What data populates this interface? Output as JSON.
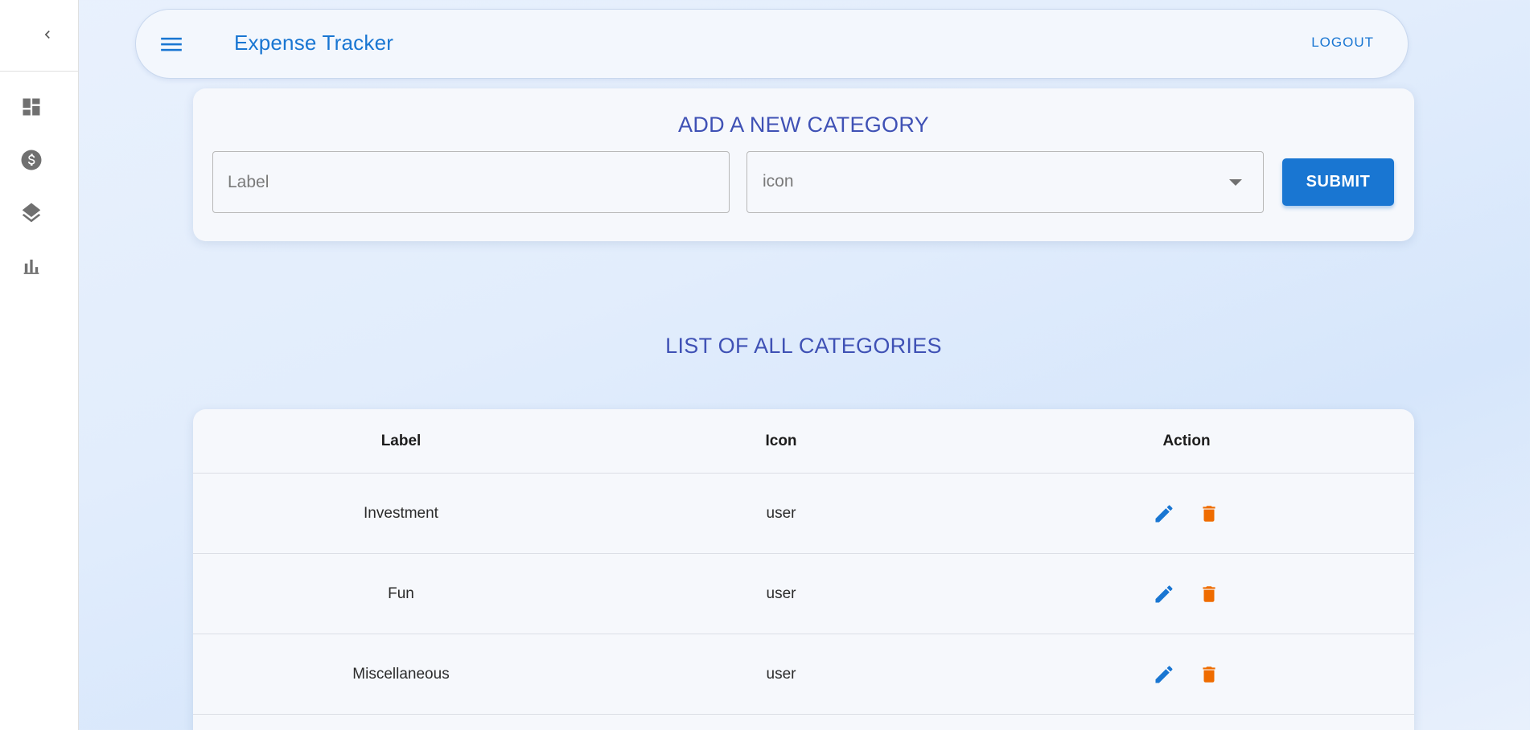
{
  "sidebar": {
    "collapse_icon": "chevron-left-icon",
    "items": [
      {
        "name": "dashboard",
        "icon": "dashboard-icon"
      },
      {
        "name": "expenses",
        "icon": "dollar-circle-icon"
      },
      {
        "name": "categories",
        "icon": "layers-icon"
      },
      {
        "name": "reports",
        "icon": "bar-chart-icon"
      }
    ]
  },
  "appbar": {
    "title": "Expense Tracker",
    "logout_label": "LOGOUT"
  },
  "add_category": {
    "heading": "ADD A NEW CATEGORY",
    "label_placeholder": "Label",
    "icon_select_value": "icon",
    "submit_label": "SUBMIT"
  },
  "list": {
    "heading": "LIST OF ALL CATEGORIES",
    "columns": [
      "Label",
      "Icon",
      "Action"
    ],
    "rows": [
      {
        "label": "Investment",
        "icon": "user"
      },
      {
        "label": "Fun",
        "icon": "user"
      },
      {
        "label": "Miscellaneous",
        "icon": "user"
      }
    ]
  },
  "colors": {
    "primary": "#1976d2",
    "heading": "#3f51b5",
    "delete": "#ef6c00",
    "icon_gray": "#707070"
  }
}
